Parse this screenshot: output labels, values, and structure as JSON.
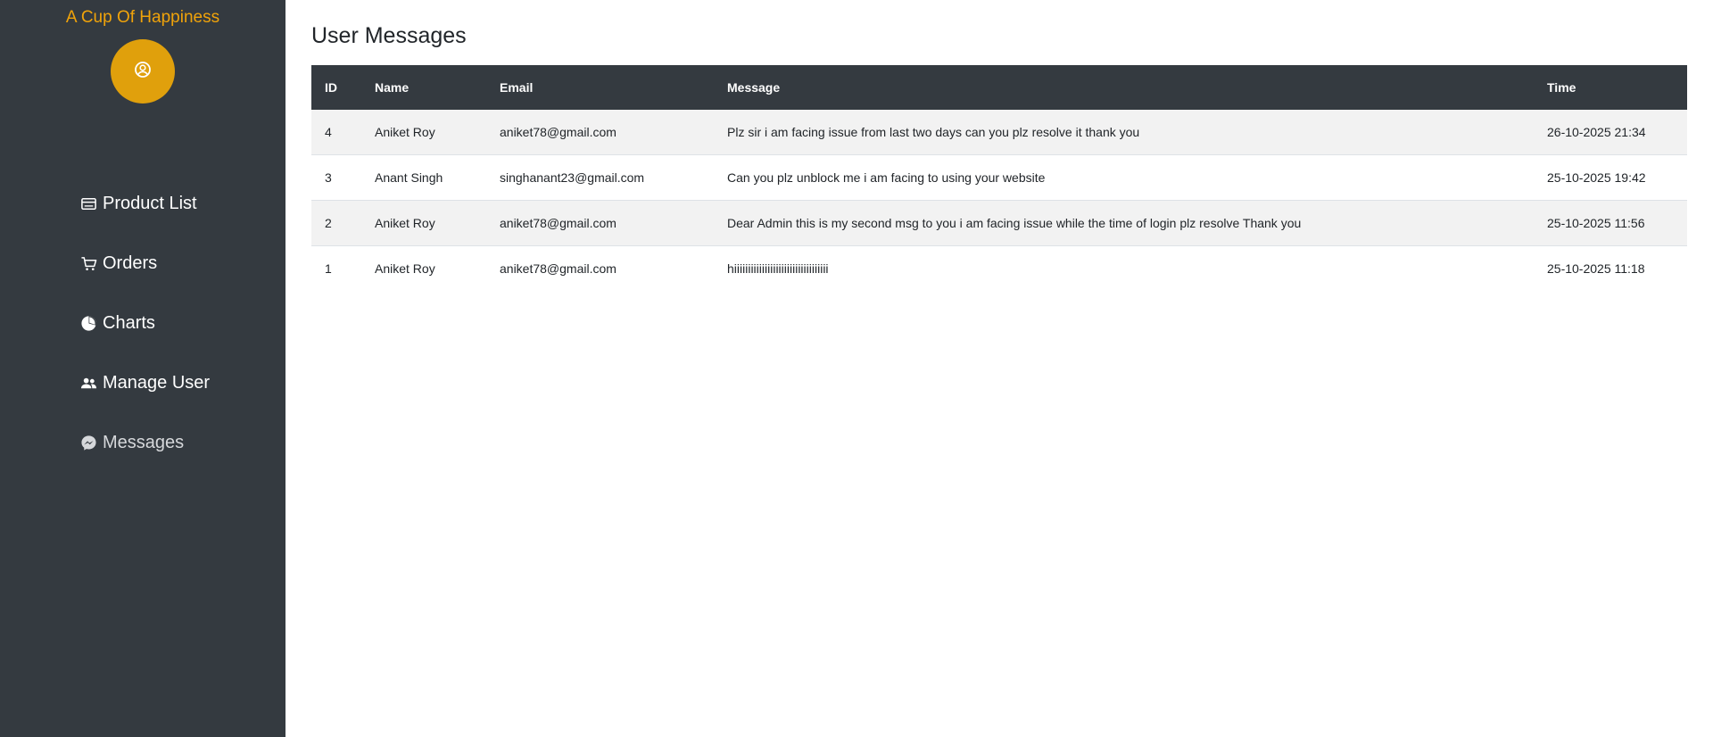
{
  "sidebar": {
    "brand": "A Cup Of Happiness",
    "avatar_icon": "user-circle-icon",
    "items": [
      {
        "label": "Product List",
        "icon": "card-icon"
      },
      {
        "label": "Orders",
        "icon": "cart-icon"
      },
      {
        "label": "Charts",
        "icon": "pie-chart-icon"
      },
      {
        "label": "Manage User",
        "icon": "users-icon"
      },
      {
        "label": "Messages",
        "icon": "messenger-icon",
        "active": true
      }
    ]
  },
  "main": {
    "title": "User Messages",
    "table": {
      "headers": [
        "ID",
        "Name",
        "Email",
        "Message",
        "Time"
      ],
      "rows": [
        {
          "id": "4",
          "name": "Aniket Roy",
          "email": "aniket78@gmail.com",
          "message": "Plz sir i am facing issue from last two days can you plz resolve it thank you",
          "time": "26-10-2025 21:34"
        },
        {
          "id": "3",
          "name": "Anant Singh",
          "email": "singhanant23@gmail.com",
          "message": "Can you plz unblock me i am facing to using your website",
          "time": "25-10-2025 19:42"
        },
        {
          "id": "2",
          "name": "Aniket Roy",
          "email": "aniket78@gmail.com",
          "message": "Dear Admin this is my second msg to you i am facing issue while the time of login plz resolve Thank you",
          "time": "25-10-2025 11:56"
        },
        {
          "id": "1",
          "name": "Aniket Roy",
          "email": "aniket78@gmail.com",
          "message": "hiiiiiiiiiiiiiiiiiiiiiiiiiiiiiiiiii",
          "time": "25-10-2025 11:18"
        }
      ]
    }
  },
  "colors": {
    "sidebar_bg": "#343a40",
    "brand": "#f0a30a",
    "avatar_bg": "#e0a00c",
    "table_header_bg": "#343a40",
    "row_stripe": "#f2f2f2"
  }
}
